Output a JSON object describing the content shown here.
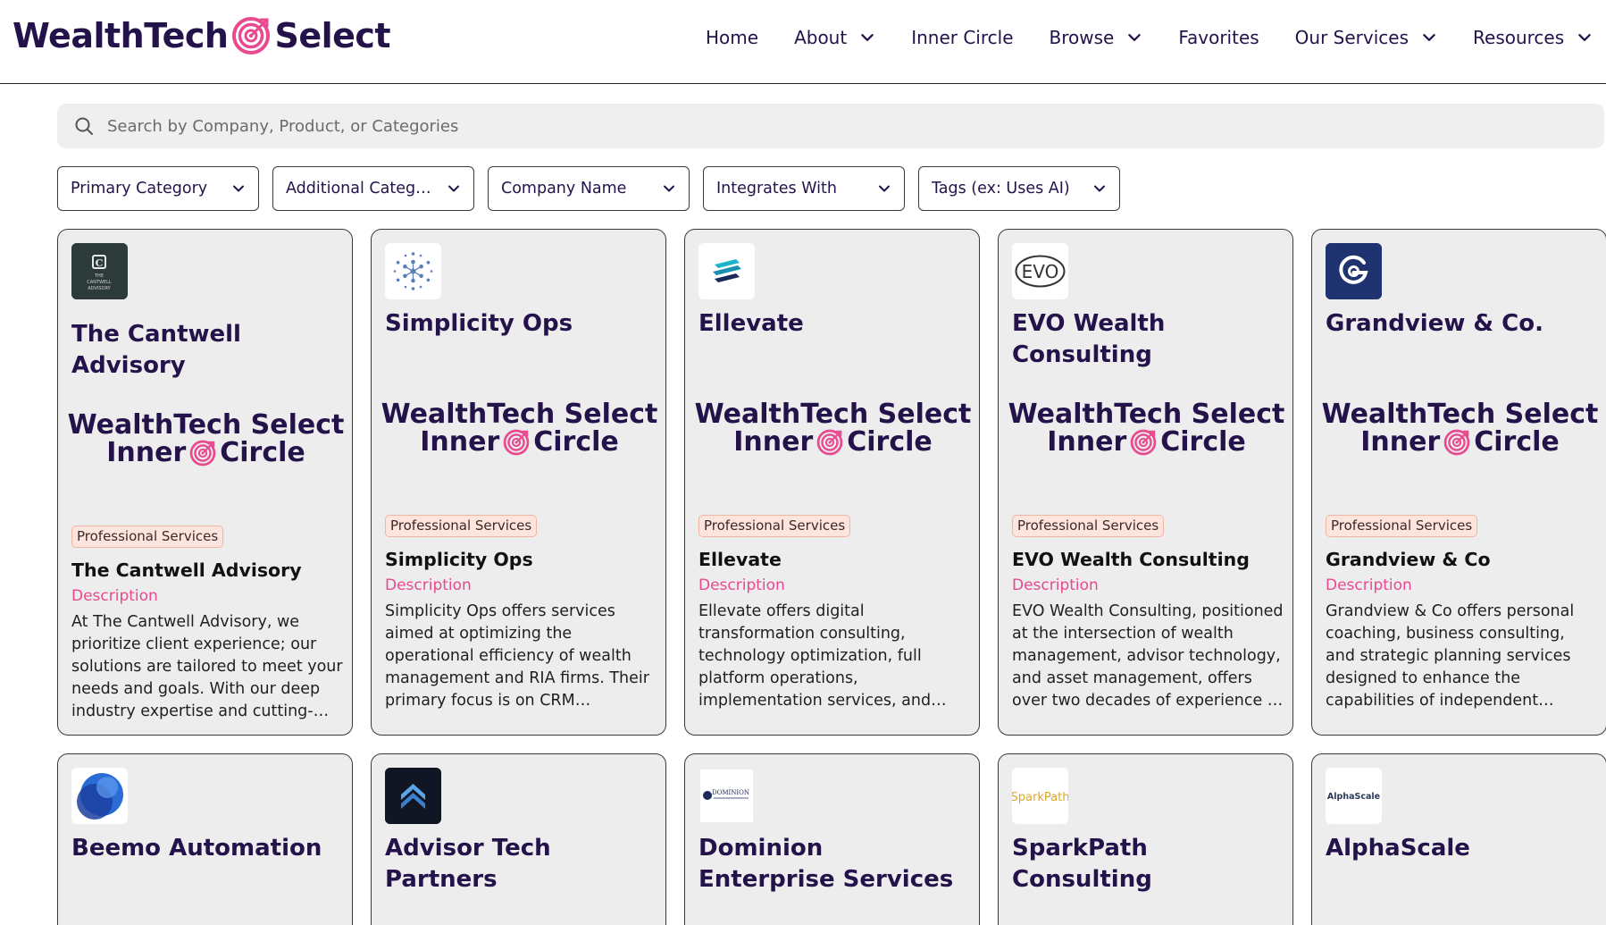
{
  "header": {
    "logo_left": "WealthTech",
    "logo_right": "Select",
    "nav": [
      {
        "label": "Home",
        "dropdown": false
      },
      {
        "label": "About",
        "dropdown": true
      },
      {
        "label": "Inner Circle",
        "dropdown": false
      },
      {
        "label": "Browse",
        "dropdown": true
      },
      {
        "label": "Favorites",
        "dropdown": false
      },
      {
        "label": "Our Services",
        "dropdown": true
      },
      {
        "label": "Resources",
        "dropdown": true
      }
    ]
  },
  "search": {
    "placeholder": "Search by Company, Product, or Categories",
    "value": ""
  },
  "filters": [
    {
      "label": "Primary Category"
    },
    {
      "label": "Additional Catego..."
    },
    {
      "label": "Company Name"
    },
    {
      "label": "Integrates With"
    },
    {
      "label": "Tags (ex: Uses AI)"
    }
  ],
  "banner": {
    "line1": "WealthTech Select",
    "line2_left": "Inner",
    "line2_right": "Circle"
  },
  "colors": {
    "brand_navy": "#24124a",
    "brand_pink": "#e8498f",
    "card_bg": "#ededed",
    "badge_bg": "#fde4dc"
  },
  "cards": [
    {
      "title": "The Cantwell Advisory",
      "logo": "cantwell-logo",
      "logo_text": "THE CANTWELL ADVISORY",
      "badge": "Professional Services",
      "name": "The Cantwell Advisory",
      "desc_label": "Description",
      "description": "At The Cantwell Advisory, we prioritize client experience; our solutions are tailored to meet your needs and goals. With our deep industry expertise and cutting-edge technology..."
    },
    {
      "title": "Simplicity Ops",
      "logo": "simplicity-logo",
      "badge": "Professional Services",
      "name": "Simplicity Ops",
      "desc_label": "Description",
      "description": "Simplicity Ops offers services aimed at optimizing the operational efficiency of wealth management and RIA firms. Their primary focus is on CRM optimization, workflow..."
    },
    {
      "title": "Ellevate",
      "logo": "ellevate-logo",
      "badge": "Professional Services",
      "name": "Ellevate",
      "desc_label": "Description",
      "description": "Ellevate offers digital transformation consulting, technology optimization, full platform operations, implementation services, and M&A..."
    },
    {
      "title": "EVO Wealth Consulting",
      "logo": "evo-logo",
      "logo_text": "EVO",
      "badge": "Professional Services",
      "name": "EVO Wealth Consulting",
      "desc_label": "Description",
      "description": "EVO Wealth Consulting, positioned at the intersection of wealth management, advisor technology, and asset management, offers over two decades of experience in these..."
    },
    {
      "title": "Grandview & Co.",
      "logo": "grandview-logo",
      "badge": "Professional Services",
      "name": "Grandview & Co",
      "desc_label": "Description",
      "description": "Grandview & Co offers personal coaching, business consulting, and strategic planning services designed to enhance the capabilities of independent wealth..."
    },
    {
      "title": "Beemo Automation",
      "logo": "beemo-logo"
    },
    {
      "title": "Advisor Tech Partners",
      "logo": "advisor-tech-logo"
    },
    {
      "title": "Dominion Enterprise Services",
      "logo": "dominion-logo",
      "logo_text": "DOMINION"
    },
    {
      "title": "SparkPath Consulting",
      "logo": "sparkpath-logo",
      "logo_text": "SparkPath"
    },
    {
      "title": "AlphaScale",
      "logo": "alphascale-logo",
      "logo_text": "AlphaScale"
    }
  ]
}
